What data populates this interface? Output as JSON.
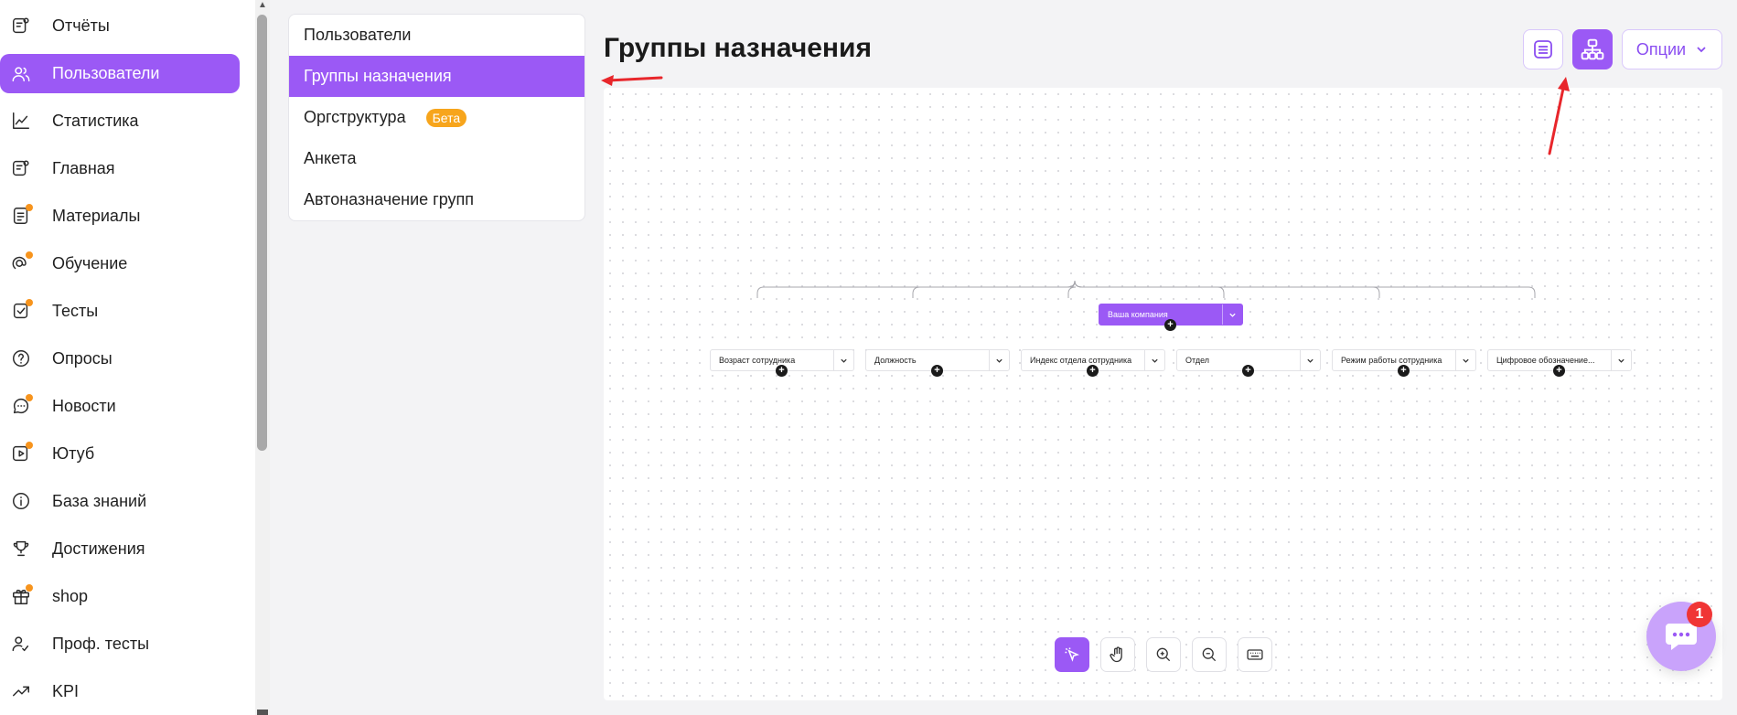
{
  "sidebar": {
    "items": [
      {
        "label": "Отчёты",
        "icon": "report-icon",
        "dot": false
      },
      {
        "label": "Пользователи",
        "icon": "users-icon",
        "dot": false,
        "active": true
      },
      {
        "label": "Статистика",
        "icon": "stats-icon",
        "dot": false
      },
      {
        "label": "Главная",
        "icon": "home-icon",
        "dot": false
      },
      {
        "label": "Материалы",
        "icon": "materials-icon",
        "dot": true
      },
      {
        "label": "Обучение",
        "icon": "learning-icon",
        "dot": true
      },
      {
        "label": "Тесты",
        "icon": "tests-icon",
        "dot": true
      },
      {
        "label": "Опросы",
        "icon": "polls-icon",
        "dot": false
      },
      {
        "label": "Новости",
        "icon": "news-icon",
        "dot": true
      },
      {
        "label": "Ютуб",
        "icon": "youtube-icon",
        "dot": true
      },
      {
        "label": "База знаний",
        "icon": "info-icon",
        "dot": false
      },
      {
        "label": "Достижения",
        "icon": "trophy-icon",
        "dot": false
      },
      {
        "label": "shop",
        "icon": "gift-icon",
        "dot": true
      },
      {
        "label": "Проф. тесты",
        "icon": "prof-tests-icon",
        "dot": false
      },
      {
        "label": "KPI",
        "icon": "kpi-icon",
        "dot": false
      }
    ]
  },
  "submenu": {
    "items": [
      {
        "label": "Пользователи"
      },
      {
        "label": "Группы назначения",
        "active": true
      },
      {
        "label": "Оргструктура",
        "badge": "Бета"
      },
      {
        "label": "Анкета"
      },
      {
        "label": "Автоназначение групп"
      }
    ]
  },
  "main": {
    "title": "Группы назначения",
    "options_label": "Опции"
  },
  "tree": {
    "root": "Ваша компания",
    "children": [
      "Возраст сотрудника",
      "Должность",
      "Индекс отдела сотрудника",
      "Отдел",
      "Режим работы сотрудника",
      "Цифровое обозначение..."
    ]
  },
  "chat": {
    "badge_count": "1"
  },
  "colors": {
    "accent": "#9b59f5",
    "badge": "#f7a51c",
    "annotation": "#e8262b"
  }
}
